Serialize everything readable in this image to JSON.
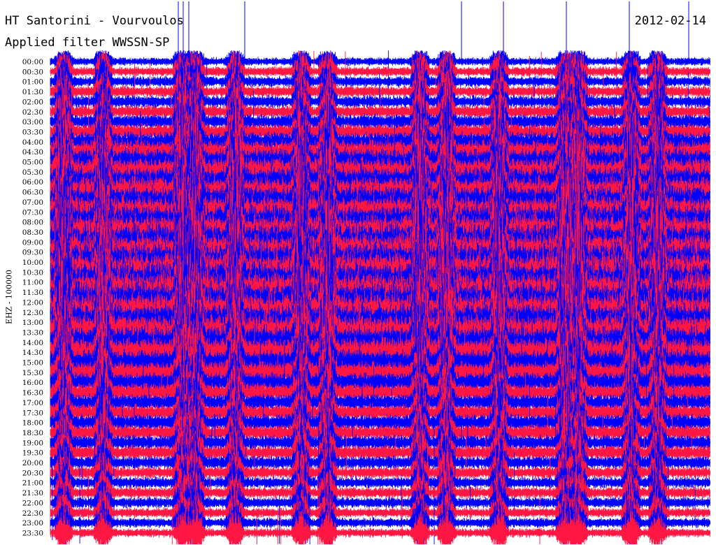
{
  "chart_data": {
    "type": "helicorder",
    "title": "HT Santorini - Vourvoulos",
    "date": "2012-02-14",
    "filter": "Applied filter WWSSN-SP",
    "channel": "EHZ - 100000",
    "rows": [
      "00:00",
      "00:30",
      "01:00",
      "01:30",
      "02:00",
      "02:30",
      "03:00",
      "03:30",
      "04:00",
      "04:30",
      "05:00",
      "05:30",
      "06:00",
      "06:30",
      "07:00",
      "07:30",
      "08:00",
      "08:30",
      "09:00",
      "09:30",
      "10:00",
      "10:30",
      "11:00",
      "11:30",
      "12:00",
      "12:30",
      "13:00",
      "13:30",
      "14:00",
      "14:30",
      "15:00",
      "15:30",
      "16:00",
      "16:30",
      "17:00",
      "17:30",
      "18:00",
      "18:30",
      "19:00",
      "19:30",
      "20:00",
      "20:30",
      "21:00",
      "21:30",
      "22:00",
      "22:30",
      "23:00",
      "23:30"
    ],
    "trace_colors": [
      "#0000ff",
      "#ff1744"
    ],
    "minutes_per_row": 30,
    "activity": [
      1,
      1.2,
      1.3,
      1.4,
      1.5,
      1.6,
      1.8,
      2.0,
      2.4,
      2.8,
      3.2,
      3.5,
      3.6,
      3.8,
      3.9,
      4.0,
      4.2,
      4.3,
      4.5,
      4.6,
      4.8,
      5.0,
      5.0,
      5.0,
      5.0,
      4.8,
      4.6,
      4.4,
      4.0,
      3.6,
      3.0,
      2.6,
      2.4,
      2.2,
      2.0,
      2.0,
      2.0,
      1.9,
      1.8,
      1.8,
      1.6,
      1.5,
      1.4,
      1.4,
      1.3,
      1.2,
      1.2,
      1.1
    ]
  }
}
